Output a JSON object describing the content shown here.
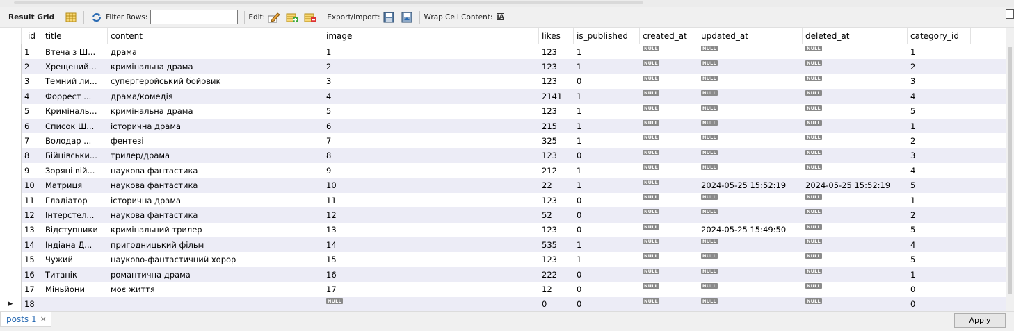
{
  "toolbar": {
    "result_grid_label": "Result Grid",
    "filter_rows_label": "Filter Rows:",
    "filter_rows_value": "",
    "edit_label": "Edit:",
    "export_import_label": "Export/Import:",
    "wrap_cell_label": "Wrap Cell Content:",
    "wrap_icon_glyph": "IA",
    "icons": [
      "grid-view-icon",
      "refresh-icon",
      "edit-row-icon",
      "add-row-icon",
      "delete-row-icon",
      "export-icon",
      "import-icon",
      "wrap-text-icon"
    ]
  },
  "columns": {
    "id": "id",
    "title": "title",
    "content": "content",
    "image": "image",
    "likes": "likes",
    "is_published": "is_published",
    "created_at": "created_at",
    "updated_at": "updated_at",
    "deleted_at": "deleted_at",
    "category_id": "category_id"
  },
  "null_text": "NULL",
  "rows": [
    {
      "id": "1",
      "title": "Втеча з Ш...",
      "content": "драма",
      "image": "1",
      "likes": "123",
      "is_published": "1",
      "created_at": null,
      "updated_at": null,
      "deleted_at": null,
      "category_id": "1"
    },
    {
      "id": "2",
      "title": "Хрещений...",
      "content": "кримінальна драма",
      "image": "2",
      "likes": "123",
      "is_published": "1",
      "created_at": null,
      "updated_at": null,
      "deleted_at": null,
      "category_id": "2"
    },
    {
      "id": "3",
      "title": "Темний ли...",
      "content": "супергеройський бойовик",
      "image": "3",
      "likes": "123",
      "is_published": "0",
      "created_at": null,
      "updated_at": null,
      "deleted_at": null,
      "category_id": "3"
    },
    {
      "id": "4",
      "title": "Форрест ...",
      "content": "драма/комедія",
      "image": "4",
      "likes": "2141",
      "is_published": "1",
      "created_at": null,
      "updated_at": null,
      "deleted_at": null,
      "category_id": "4"
    },
    {
      "id": "5",
      "title": "Криміналь...",
      "content": " кримінальна драма",
      "image": "5",
      "likes": "123",
      "is_published": "1",
      "created_at": null,
      "updated_at": null,
      "deleted_at": null,
      "category_id": "5"
    },
    {
      "id": "6",
      "title": "Список Ш...",
      "content": "історична драма",
      "image": "6",
      "likes": "215",
      "is_published": "1",
      "created_at": null,
      "updated_at": null,
      "deleted_at": null,
      "category_id": "1"
    },
    {
      "id": "7",
      "title": "Володар ...",
      "content": "фентезі",
      "image": "7",
      "likes": "325",
      "is_published": "1",
      "created_at": null,
      "updated_at": null,
      "deleted_at": null,
      "category_id": "2"
    },
    {
      "id": "8",
      "title": "Бійцівськи...",
      "content": "трилер/драма",
      "image": "8",
      "likes": "123",
      "is_published": "0",
      "created_at": null,
      "updated_at": null,
      "deleted_at": null,
      "category_id": "3"
    },
    {
      "id": "9",
      "title": "Зоряні вій...",
      "content": "наукова фантастика",
      "image": "9",
      "likes": "212",
      "is_published": "1",
      "created_at": null,
      "updated_at": null,
      "deleted_at": null,
      "category_id": "4"
    },
    {
      "id": "10",
      "title": "Матриця",
      "content": "наукова фантастика",
      "image": "10",
      "likes": "22",
      "is_published": "1",
      "created_at": null,
      "updated_at": "2024-05-25 15:52:19",
      "deleted_at": "2024-05-25 15:52:19",
      "category_id": "5"
    },
    {
      "id": "11",
      "title": "Гладіатор",
      "content": "історична драма",
      "image": "11",
      "likes": "123",
      "is_published": "0",
      "created_at": null,
      "updated_at": null,
      "deleted_at": null,
      "category_id": "1"
    },
    {
      "id": "12",
      "title": "Інтерстел...",
      "content": "наукова фантастика",
      "image": "12",
      "likes": "52",
      "is_published": "0",
      "created_at": null,
      "updated_at": null,
      "deleted_at": null,
      "category_id": "2"
    },
    {
      "id": "13",
      "title": "Відступники",
      "content": "кримінальний трилер",
      "image": "13",
      "likes": "123",
      "is_published": "0",
      "created_at": null,
      "updated_at": "2024-05-25 15:49:50",
      "deleted_at": null,
      "category_id": "5"
    },
    {
      "id": "14",
      "title": "Індіана Д...",
      "content": "пригодницький фільм",
      "image": "14",
      "likes": "535",
      "is_published": "1",
      "created_at": null,
      "updated_at": null,
      "deleted_at": null,
      "category_id": "4"
    },
    {
      "id": "15",
      "title": "Чужий",
      "content": "науково-фантастичний хорор",
      "image": "15",
      "likes": "123",
      "is_published": "1",
      "created_at": null,
      "updated_at": null,
      "deleted_at": null,
      "category_id": "5"
    },
    {
      "id": "16",
      "title": "Титанік",
      "content": "романтична драма",
      "image": "16",
      "likes": "222",
      "is_published": "0",
      "created_at": null,
      "updated_at": null,
      "deleted_at": null,
      "category_id": "1"
    },
    {
      "id": "17",
      "title": "Міньйони",
      "content": "моє життя",
      "image": "17",
      "likes": "12",
      "is_published": "0",
      "created_at": null,
      "updated_at": null,
      "deleted_at": null,
      "category_id": "0"
    },
    {
      "id": "18",
      "title": "",
      "content": "",
      "image": null,
      "likes": "0",
      "is_published": "0",
      "created_at": null,
      "updated_at": null,
      "deleted_at": null,
      "category_id": "0",
      "current": true
    }
  ],
  "current_row_marker": "▶",
  "bottom": {
    "tab_label": "posts 1",
    "tab_close": "×",
    "apply_label": "Apply"
  },
  "colors": {
    "row_stripe": "#ececf6",
    "tab_text": "#2a6bb3",
    "null_badge": "#8a8a8a"
  }
}
